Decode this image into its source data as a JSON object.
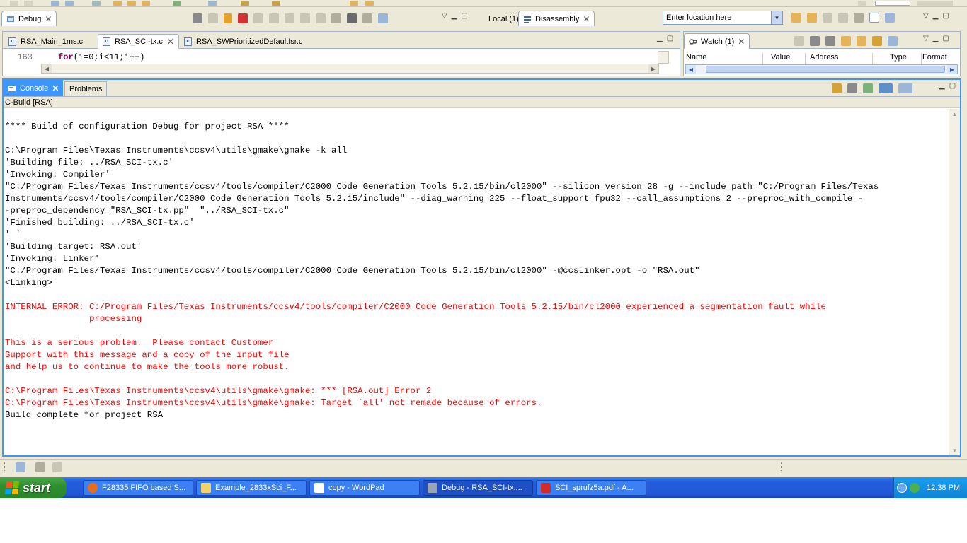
{
  "debug_view": {
    "tab_label": "Debug"
  },
  "right_views": {
    "local_tab": "Local (1)",
    "disassembly_tab": "Disassembly"
  },
  "location": {
    "placeholder": "Enter location here"
  },
  "editor": {
    "tabs": [
      "RSA_Main_1ms.c",
      "RSA_SCI-tx.c",
      "RSA_SWPrioritizedDefaultIsr.c"
    ],
    "active_tab_index": 1,
    "line_number": "163",
    "code_keyword": "for",
    "code_rest": "(i=0;i<11;i++)"
  },
  "watch": {
    "tab_label": "Watch (1)",
    "columns": [
      "Name",
      "Value",
      "Address",
      "Type",
      "Format"
    ]
  },
  "console": {
    "tab_label": "Console",
    "problems_label": "Problems",
    "subheader": "C-Build [RSA]",
    "lines": [
      {
        "text": "",
        "color": "black"
      },
      {
        "text": "**** Build of configuration Debug for project RSA ****",
        "color": "black"
      },
      {
        "text": "",
        "color": "black"
      },
      {
        "text": "C:\\Program Files\\Texas Instruments\\ccsv4\\utils\\gmake\\gmake -k all",
        "color": "black"
      },
      {
        "text": "'Building file: ../RSA_SCI-tx.c'",
        "color": "black"
      },
      {
        "text": "'Invoking: Compiler'",
        "color": "black"
      },
      {
        "text": "\"C:/Program Files/Texas Instruments/ccsv4/tools/compiler/C2000 Code Generation Tools 5.2.15/bin/cl2000\" --silicon_version=28 -g --include_path=\"C:/Program Files/Texas",
        "color": "black"
      },
      {
        "text": "Instruments/ccsv4/tools/compiler/C2000 Code Generation Tools 5.2.15/include\" --diag_warning=225 --float_support=fpu32 --call_assumptions=2 --preproc_with_compile -",
        "color": "black"
      },
      {
        "text": "-preproc_dependency=\"RSA_SCI-tx.pp\"  \"../RSA_SCI-tx.c\"",
        "color": "black"
      },
      {
        "text": "'Finished building: ../RSA_SCI-tx.c'",
        "color": "black"
      },
      {
        "text": "' '",
        "color": "black"
      },
      {
        "text": "'Building target: RSA.out'",
        "color": "black"
      },
      {
        "text": "'Invoking: Linker'",
        "color": "black"
      },
      {
        "text": "\"C:/Program Files/Texas Instruments/ccsv4/tools/compiler/C2000 Code Generation Tools 5.2.15/bin/cl2000\" -@ccsLinker.opt -o \"RSA.out\"",
        "color": "black"
      },
      {
        "text": "<Linking>",
        "color": "black"
      },
      {
        "text": "",
        "color": "black"
      },
      {
        "text": "INTERNAL ERROR: C:/Program Files/Texas Instruments/ccsv4/tools/compiler/C2000 Code Generation Tools 5.2.15/bin/cl2000 experienced a segmentation fault while",
        "color": "red"
      },
      {
        "text": "                processing",
        "color": "red"
      },
      {
        "text": "",
        "color": "black"
      },
      {
        "text": "This is a serious problem.  Please contact Customer",
        "color": "red"
      },
      {
        "text": "Support with this message and a copy of the input file",
        "color": "red"
      },
      {
        "text": "and help us to continue to make the tools more robust.",
        "color": "red"
      },
      {
        "text": "",
        "color": "black"
      },
      {
        "text": "C:\\Program Files\\Texas Instruments\\ccsv4\\utils\\gmake\\gmake: *** [RSA.out] Error 2",
        "color": "red"
      },
      {
        "text": "C:\\Program Files\\Texas Instruments\\ccsv4\\utils\\gmake\\gmake: Target `all' not remade because of errors.",
        "color": "red"
      },
      {
        "text": "Build complete for project RSA",
        "color": "black"
      }
    ]
  },
  "taskbar": {
    "start_label": "start",
    "items": [
      "F28335 FIFO based S...",
      "Example_2833xSci_F...",
      "copy - WordPad",
      "Debug - RSA_SCI-tx....",
      "SCI_sprufz5a.pdf - A..."
    ],
    "active_index": 3,
    "clock": "12:38 PM"
  },
  "colors": {
    "accent": "#3d95ff",
    "error_text": "#ff0000",
    "taskbar": "#245edb",
    "start": "#2f8f2f"
  }
}
